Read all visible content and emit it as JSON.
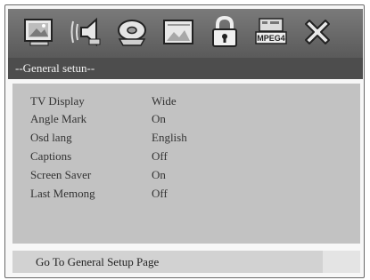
{
  "toolbar": {
    "icons": [
      "general-setup-icon",
      "audio-setup-icon",
      "video-setup-icon",
      "preference-icon",
      "password-icon",
      "mpeg4-icon",
      "exit-icon"
    ],
    "mpeg4_label": "MPEG4"
  },
  "header": {
    "title": "--General setun--"
  },
  "settings": [
    {
      "label": "TV Display",
      "value": "Wide"
    },
    {
      "label": "Angle Mark",
      "value": "On"
    },
    {
      "label": "Osd lang",
      "value": "English"
    },
    {
      "label": "Captions",
      "value": "Off"
    },
    {
      "label": "Screen Saver",
      "value": "On"
    },
    {
      "label": "Last Memong",
      "value": "Off"
    }
  ],
  "footer": {
    "hint": "Go To General Setup Page"
  },
  "colors": {
    "toolbar": "#6a6a6a",
    "header": "#4d4d4d",
    "panel": "#c2c2c2",
    "footer": "#d2d2d2"
  }
}
